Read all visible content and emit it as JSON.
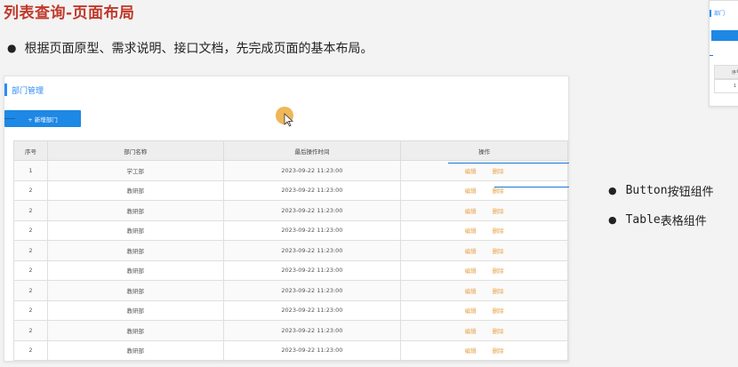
{
  "slide": {
    "title": "列表查询-页面布局",
    "bullet": "根据页面原型、需求说明、接口文档，先完成页面的基本布局。",
    "components": [
      {
        "name": "Button",
        "suffix": "按钮组件"
      },
      {
        "name": "Table",
        "suffix": "表格组件"
      }
    ]
  },
  "prototype": {
    "title": "部门管理",
    "add_button_label": "+ 新增部门",
    "table": {
      "headers": [
        "序号",
        "部门名称",
        "最后操作时间",
        "操作"
      ],
      "rows": [
        {
          "idx": "1",
          "name": "学工部",
          "time": "2023-09-22 11:23:00"
        },
        {
          "idx": "2",
          "name": "教研部",
          "time": "2023-09-22 11:23:00"
        },
        {
          "idx": "2",
          "name": "教研部",
          "time": "2023-09-22 11:23:00"
        },
        {
          "idx": "2",
          "name": "教研部",
          "time": "2023-09-22 11:23:00"
        },
        {
          "idx": "2",
          "name": "教研部",
          "time": "2023-09-22 11:23:00"
        },
        {
          "idx": "2",
          "name": "教研部",
          "time": "2023-09-22 11:23:00"
        },
        {
          "idx": "2",
          "name": "教研部",
          "time": "2023-09-22 11:23:00"
        },
        {
          "idx": "2",
          "name": "教研部",
          "time": "2023-09-22 11:23:00"
        },
        {
          "idx": "2",
          "name": "教研部",
          "time": "2023-09-22 11:23:00"
        },
        {
          "idx": "2",
          "name": "教研部",
          "time": "2023-09-22 11:23:00"
        }
      ],
      "edit_label": "编辑",
      "delete_label": "删除"
    }
  },
  "thumbnail": {
    "title": "部门",
    "header_text": "序号",
    "row_text": "1"
  },
  "colors": {
    "title_red": "#c0392b",
    "primary_blue": "#1e88e5",
    "accent_blue": "#2d8cf0",
    "link_orange": "#e8a44a"
  },
  "icons": [
    "bullet-dot-icon",
    "mouse-pointer-icon"
  ]
}
